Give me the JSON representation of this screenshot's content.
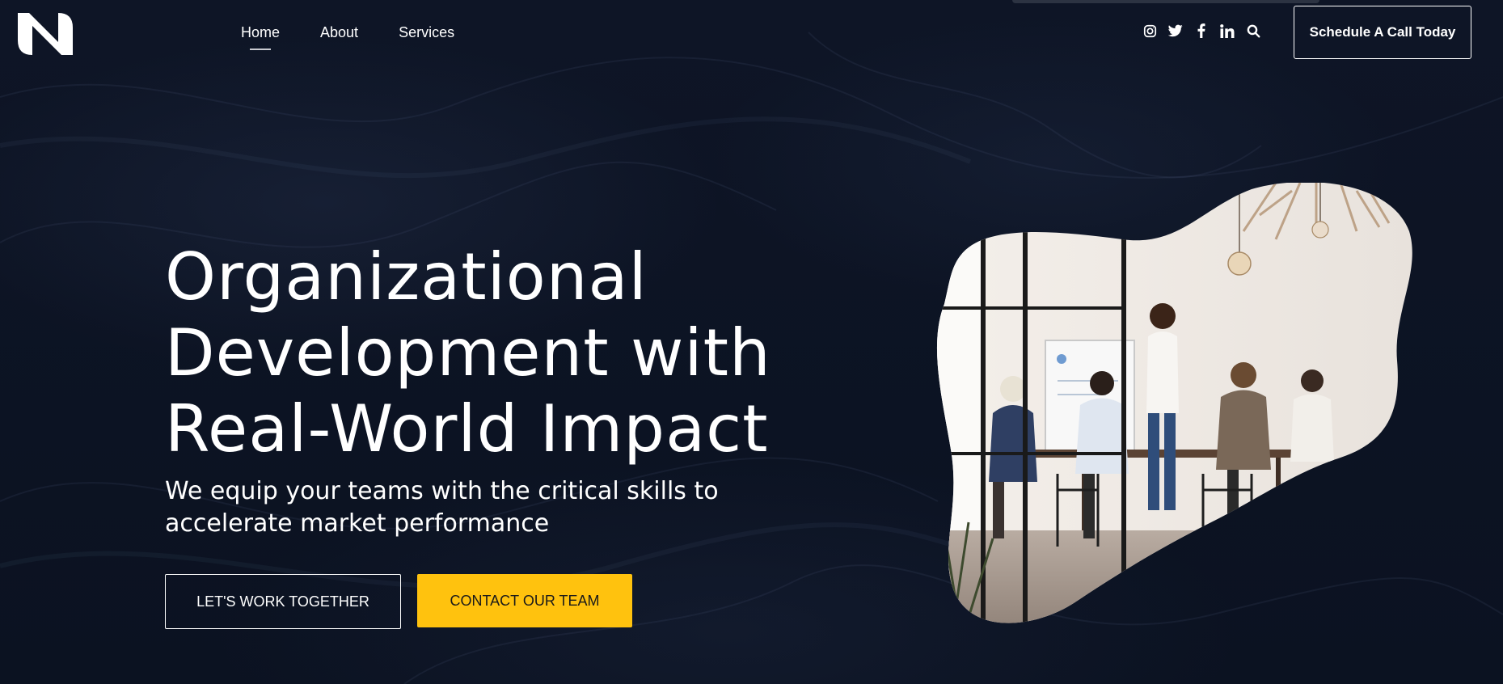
{
  "header": {
    "logo_name": "brand-logo",
    "nav": [
      {
        "label": "Home",
        "active": true
      },
      {
        "label": "About",
        "active": false
      },
      {
        "label": "Services",
        "active": false
      }
    ],
    "socials": [
      "instagram-icon",
      "twitter-icon",
      "facebook-icon",
      "linkedin-icon",
      "search-icon"
    ],
    "cta_label": "Schedule A Call Today"
  },
  "hero": {
    "title_lines": [
      "Organizational",
      "Development with",
      "Real-World Impact"
    ],
    "subtitle_lines": [
      "We equip your teams with the critical skills to",
      "accelerate market performance"
    ],
    "primary_button": "LET'S WORK TOGETHER",
    "secondary_button": "CONTACT OUR TEAM",
    "image_alt": "team meeting photo"
  },
  "colors": {
    "background": "#0d1424",
    "accent": "#ffc20e",
    "text": "#ffffff"
  }
}
